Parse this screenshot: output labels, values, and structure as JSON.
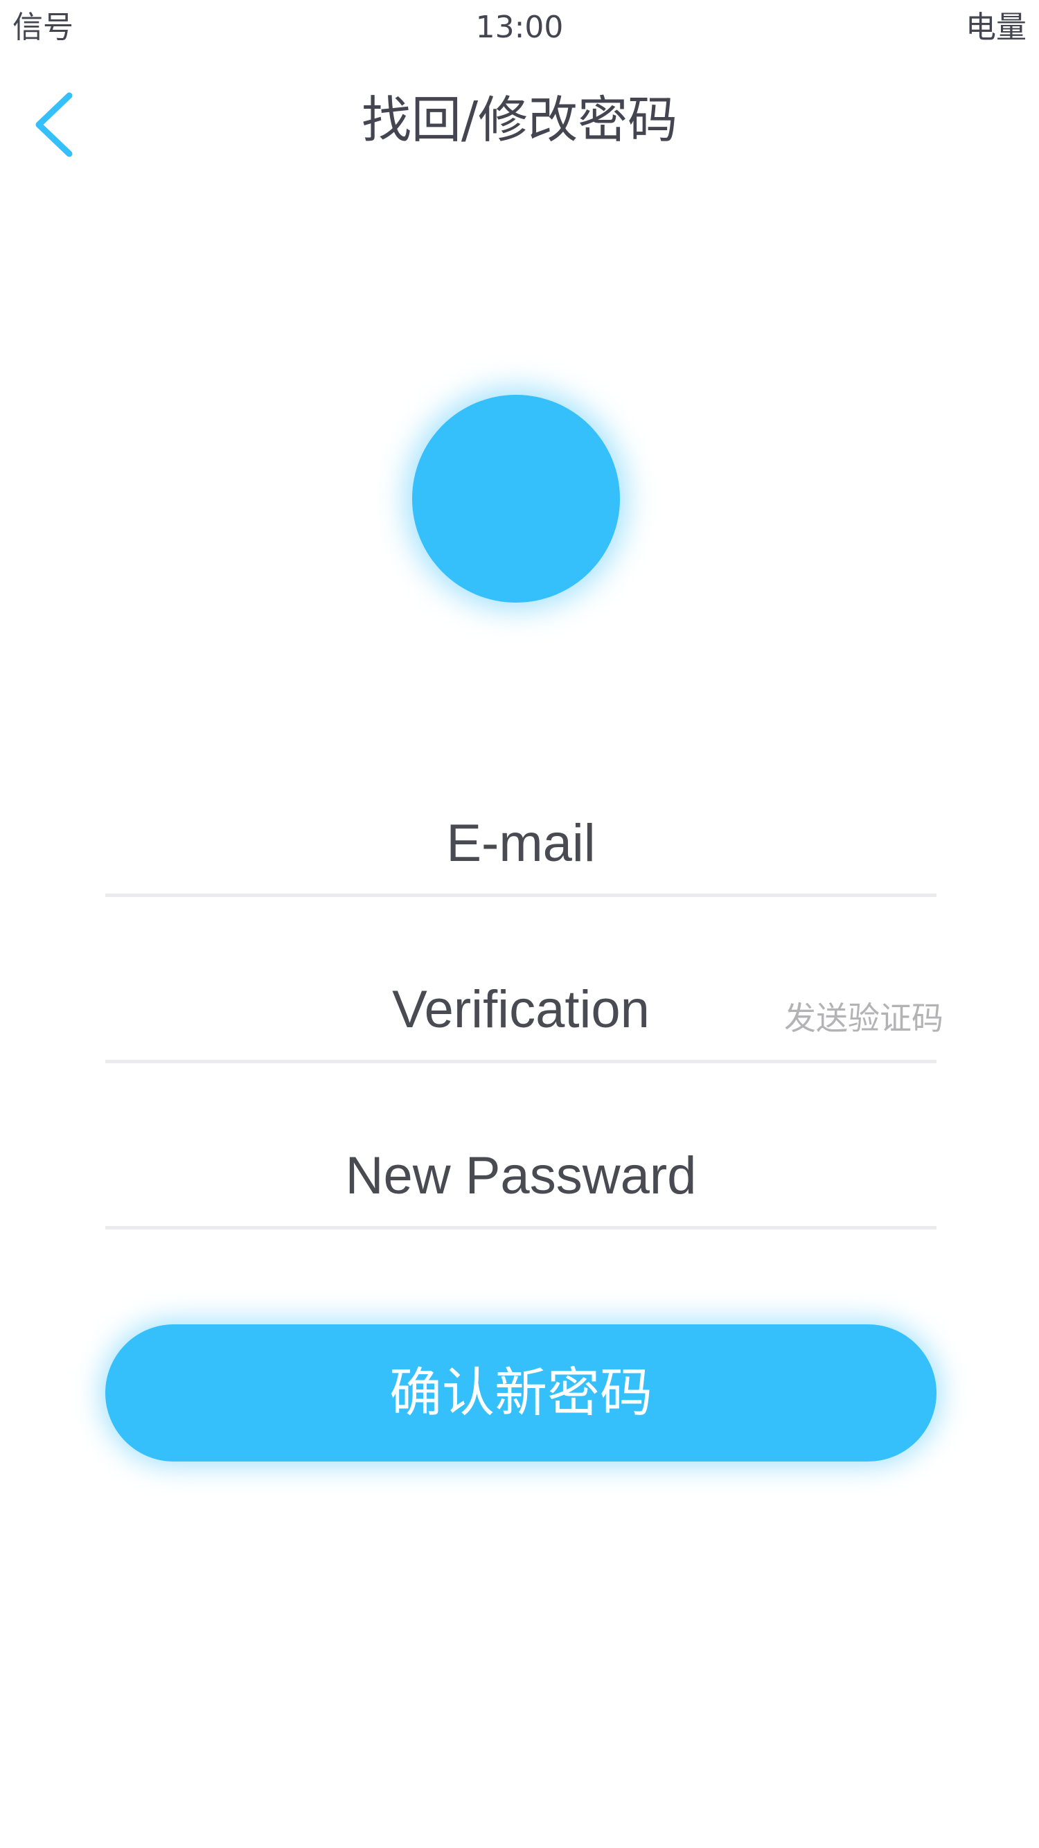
{
  "status_bar": {
    "signal": "信号",
    "time": "13:00",
    "battery": "电量"
  },
  "nav": {
    "back_icon": "chevron-left-icon",
    "title": "找回/修改密码"
  },
  "avatar": {
    "color": "#35bffb"
  },
  "form": {
    "email_placeholder": "E-mail",
    "code_placeholder": "Verification",
    "send_code_label": "发送验证码",
    "password_placeholder": "New Passward"
  },
  "confirm_button": {
    "label": "确认新密码"
  },
  "colors": {
    "accent": "#35bffb",
    "text": "#4a4b52",
    "muted": "#b3b3b6",
    "divider": "#ebebed"
  }
}
